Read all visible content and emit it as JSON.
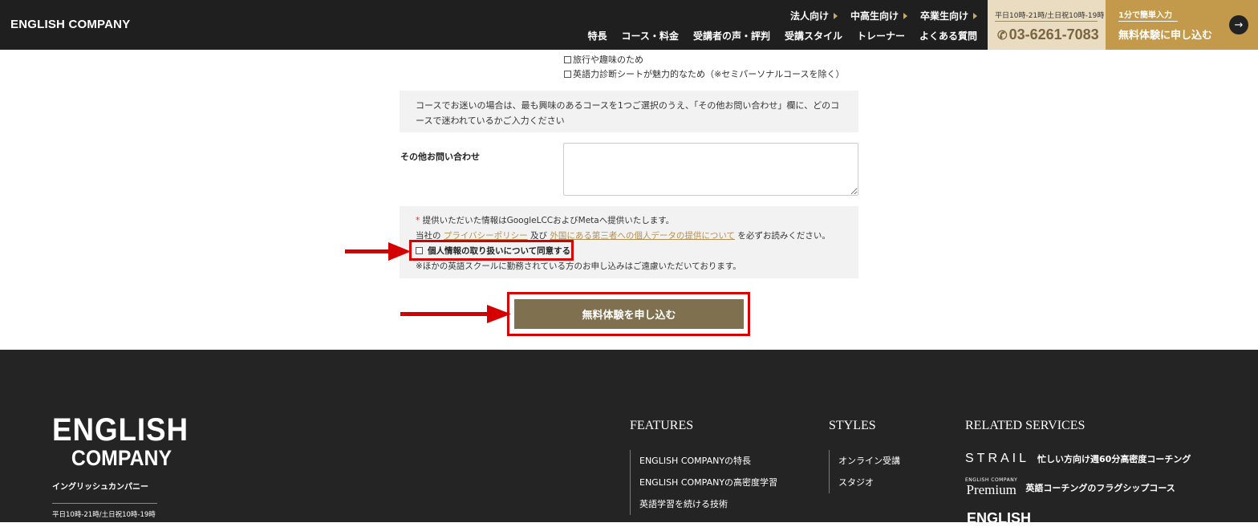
{
  "header": {
    "logo": "ENGLISH COMPANY",
    "top_nav": [
      "法人向け",
      "中高生向け",
      "卒業生向け"
    ],
    "main_nav": [
      "特長",
      "コース・料金",
      "受講者の声・評判",
      "受講スタイル",
      "トレーナー",
      "よくある質問"
    ],
    "phone": {
      "hours": "平日10時-21時/土日祝10時-19時",
      "number": "03-6261-7083",
      "icon": "phone-icon"
    },
    "cta": {
      "small": "1分で簡単入力",
      "label": "無料体験に申し込む",
      "icon": "arrow-right-icon"
    }
  },
  "form": {
    "checkbox_options": [
      "旅行や趣味のため",
      "英語力診断シートが魅力的なため（※セミパーソナルコースを除く）"
    ],
    "notice_text": "コースでお迷いの場合は、最も興味のあるコースを1つご選択のうえ、「その他お問い合わせ」欄に、どのコースで迷われているかご入力ください",
    "other_inquiry_label": "その他お問い合わせ",
    "privacy": {
      "star": "*",
      "line1": "提供いただいた情報はGoogleLCCおよびMetaへ提供いたします。",
      "line2_prefix": "当社の",
      "link1": "プライバシーポリシー",
      "and": "及び",
      "link2": "外国にある第三者への個人データの提供について",
      "line2_suffix": "を必ずお読みください。",
      "agree_label": "個人情報の取り扱いについて同意する",
      "note": "※ほかの英語スクールに勤務されている方のお申し込みはご遠慮いただいております。"
    },
    "submit_label": "無料体験を申し込む",
    "highlight_color": "#d40000"
  },
  "footer": {
    "logo_line1": "ENGLISH",
    "logo_line2": "COMPANY",
    "kana": "イングリッシュカンパニー",
    "hours": "平日10時-21時/土日祝10時-19時",
    "features": {
      "heading": "FEATURES",
      "items": [
        "ENGLISH COMPANYの特長",
        "ENGLISH COMPANYの高密度学習",
        "英語学習を続ける技術"
      ]
    },
    "styles": {
      "heading": "STYLES",
      "items": [
        "オンライン受講",
        "スタジオ"
      ]
    },
    "related": {
      "heading": "RELATED SERVICES",
      "items": [
        {
          "brand": "STRAIL",
          "desc": "忙しい方向け週60分高密度コーチング"
        },
        {
          "brand_small": "ENGLISH COMPANY",
          "brand": "Premium",
          "desc": "英語コーチングのフラグシップコース"
        },
        {
          "brand": "ENGLISH"
        }
      ]
    }
  }
}
